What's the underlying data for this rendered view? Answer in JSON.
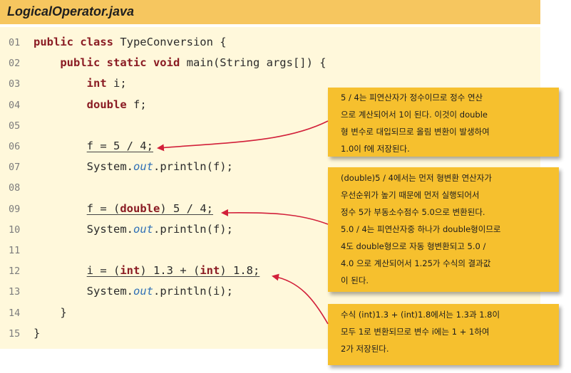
{
  "title": "LogicalOperator.java",
  "code_lines": [
    {
      "num": "01",
      "parts": [
        {
          "t": "public class",
          "c": "kw"
        },
        {
          "t": " TypeConversion {"
        }
      ]
    },
    {
      "num": "02",
      "parts": [
        {
          "t": "    "
        },
        {
          "t": "public static void",
          "c": "kw"
        },
        {
          "t": " main(String args[]) {"
        }
      ]
    },
    {
      "num": "03",
      "parts": [
        {
          "t": "        "
        },
        {
          "t": "int",
          "c": "kw"
        },
        {
          "t": " i;"
        }
      ]
    },
    {
      "num": "04",
      "parts": [
        {
          "t": "        "
        },
        {
          "t": "double",
          "c": "kw"
        },
        {
          "t": " f;"
        }
      ]
    },
    {
      "num": "05",
      "parts": []
    },
    {
      "num": "06",
      "parts": [
        {
          "t": "        "
        },
        {
          "t": "f = 5 / 4;",
          "u": true
        }
      ]
    },
    {
      "num": "07",
      "parts": [
        {
          "t": "        System."
        },
        {
          "t": "out",
          "c": "it"
        },
        {
          "t": ".println(f);"
        }
      ]
    },
    {
      "num": "08",
      "parts": []
    },
    {
      "num": "09",
      "parts": [
        {
          "t": "        "
        },
        {
          "t": "f = (",
          "u": true
        },
        {
          "t": "double",
          "c": "kw",
          "u": true
        },
        {
          "t": ") 5 / 4;",
          "u": true
        }
      ]
    },
    {
      "num": "10",
      "parts": [
        {
          "t": "        System."
        },
        {
          "t": "out",
          "c": "it"
        },
        {
          "t": ".println(f);"
        }
      ]
    },
    {
      "num": "11",
      "parts": []
    },
    {
      "num": "12",
      "parts": [
        {
          "t": "        "
        },
        {
          "t": "i = (",
          "u": true
        },
        {
          "t": "int",
          "c": "kw",
          "u": true
        },
        {
          "t": ") 1.3 + (",
          "u": true
        },
        {
          "t": "int",
          "c": "kw",
          "u": true
        },
        {
          "t": ") 1.8;",
          "u": true
        }
      ]
    },
    {
      "num": "13",
      "parts": [
        {
          "t": "        System."
        },
        {
          "t": "out",
          "c": "it"
        },
        {
          "t": ".println(i);"
        }
      ]
    },
    {
      "num": "14",
      "parts": [
        {
          "t": "    }"
        }
      ]
    },
    {
      "num": "15",
      "parts": [
        {
          "t": "}"
        }
      ]
    }
  ],
  "callouts": [
    {
      "lines": [
        "5 / 4는 피연산자가 정수이므로 정수 연산",
        "으로 계산되어서 1이 된다. 이것이 double",
        "형 변수로 대입되므로 올림 변환이 발생하여",
        "1.0이 f에 저장된다."
      ]
    },
    {
      "lines": [
        "(double)5 / 4에서는 먼저 형변환 연산자가",
        "우선순위가 높기 때문에 먼저 실행되어서",
        "정수 5가 부동소수점수 5.0으로 변환된다.",
        "5.0 / 4는 피연산자중 하나가 double형이므로",
        "4도 double형으로 자동 형변환되고 5.0 /",
        "4.0 으로 계산되어서 1.25가 수식의 결과값",
        "이 된다."
      ]
    },
    {
      "lines": [
        "수식 (int)1.3 + (int)1.8에서는 1.3과 1.8이",
        "모두 1로 변환되므로 변수 i에는 1 + 1하여",
        "2가 저장된다."
      ]
    }
  ],
  "colors": {
    "title_bar": "#f6c65f",
    "code_bg": "#fff8db",
    "keyword": "#8a1b23",
    "field": "#2f6fb6",
    "callout_bg": "#f6c02e",
    "arrow": "#d2203a"
  }
}
